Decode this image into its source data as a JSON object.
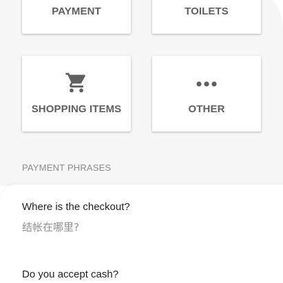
{
  "categories": {
    "payment_label": "PAYMENT",
    "toilets_label": "TOILETS",
    "shopping_label": "SHOPPING ITEMS",
    "shopping_icon": "cart-icon",
    "other_label": "OTHER",
    "other_icon": "more-dots-icon"
  },
  "section": {
    "title": "PAYMENT PHRASES"
  },
  "phrases": [
    {
      "english": "Where is the checkout?",
      "chinese": "结帐在哪里?"
    },
    {
      "english": "Do you accept cash?"
    }
  ],
  "colors": {
    "panel_background": "#f6f6f6",
    "card_text": "#5f5f5f",
    "icon": "#5f5f5f",
    "section_title": "#8a8a8a",
    "phrase_text": "#1f1f1f",
    "translation_text": "#8f8f8f"
  }
}
